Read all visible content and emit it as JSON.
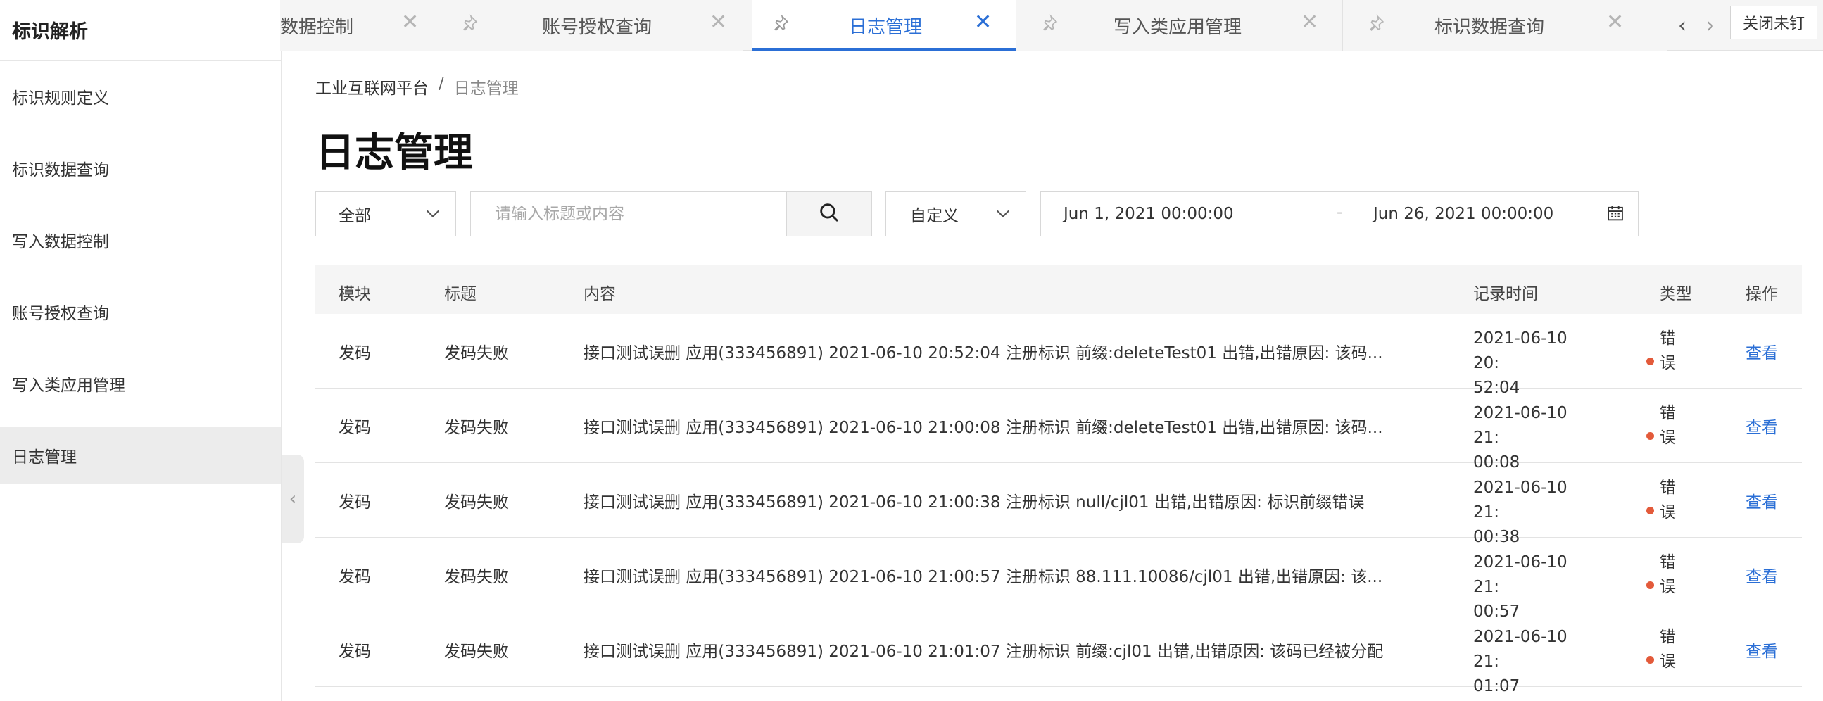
{
  "sidebar": {
    "title": "标识解析",
    "items": [
      {
        "label": "标识规则定义"
      },
      {
        "label": "标识数据查询"
      },
      {
        "label": "写入数据控制"
      },
      {
        "label": "账号授权查询"
      },
      {
        "label": "写入类应用管理"
      },
      {
        "label": "日志管理"
      }
    ],
    "active_index": 5
  },
  "tabs": [
    {
      "label": "数据控制",
      "active": false
    },
    {
      "label": "账号授权查询",
      "active": false
    },
    {
      "label": "日志管理",
      "active": true
    },
    {
      "label": "写入类应用管理",
      "active": false
    },
    {
      "label": "标识数据查询",
      "active": false
    }
  ],
  "tab_controls": {
    "close_unpinned": "关闭未钉"
  },
  "breadcrumb": {
    "root": "工业互联网平台",
    "separator": "/",
    "current": "日志管理"
  },
  "page_title": "日志管理",
  "filters": {
    "module_select": "全部",
    "search_placeholder": "请输入标题或内容",
    "range_select": "自定义",
    "date_start": "Jun 1, 2021 00:00:00",
    "date_separator": "-",
    "date_end": "Jun 26, 2021 00:00:00"
  },
  "table": {
    "headers": {
      "module": "模块",
      "title": "标题",
      "content": "内容",
      "time": "记录时间",
      "type": "类型",
      "action": "操作"
    },
    "rows": [
      {
        "module": "发码",
        "title": "发码失败",
        "content": "接口测试误删 应用(333456891) 2021-06-10 20:52:04 注册标识 前缀:deleteTest01 出错,出错原因: 该码...",
        "time_line1": "2021-06-10 20:",
        "time_line2": "52:04",
        "type_line1": "错",
        "type_line2": "误",
        "action": "查看"
      },
      {
        "module": "发码",
        "title": "发码失败",
        "content": "接口测试误删 应用(333456891) 2021-06-10 21:00:08 注册标识 前缀:deleteTest01 出错,出错原因: 该码...",
        "time_line1": "2021-06-10 21:",
        "time_line2": "00:08",
        "type_line1": "错",
        "type_line2": "误",
        "action": "查看"
      },
      {
        "module": "发码",
        "title": "发码失败",
        "content": "接口测试误删 应用(333456891) 2021-06-10 21:00:38 注册标识 null/cjl01 出错,出错原因: 标识前缀错误",
        "time_line1": "2021-06-10 21:",
        "time_line2": "00:38",
        "type_line1": "错",
        "type_line2": "误",
        "action": "查看"
      },
      {
        "module": "发码",
        "title": "发码失败",
        "content": "接口测试误删 应用(333456891) 2021-06-10 21:00:57 注册标识 88.111.10086/cjl01 出错,出错原因: 该...",
        "time_line1": "2021-06-10 21:",
        "time_line2": "00:57",
        "type_line1": "错",
        "type_line2": "误",
        "action": "查看"
      },
      {
        "module": "发码",
        "title": "发码失败",
        "content": "接口测试误删 应用(333456891) 2021-06-10 21:01:07 注册标识 前缀:cjl01 出错,出错原因: 该码已经被分配",
        "time_line1": "2021-06-10 21:",
        "time_line2": "01:07",
        "type_line1": "错",
        "type_line2": "误",
        "action": "查看"
      }
    ]
  },
  "colors": {
    "accent": "#2b6fd6",
    "error_dot": "#e35a3a"
  }
}
